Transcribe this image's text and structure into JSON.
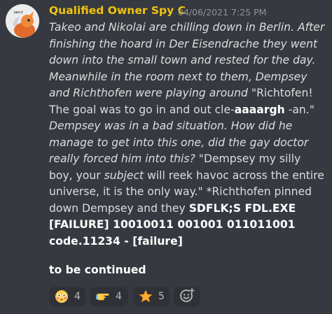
{
  "message": {
    "author": "Qualified Owner Spy C",
    "timestamp": "04/06/2021 7:25 PM",
    "body": [
      {
        "text": "Takeo and Nikolai are chilling down in Berlin. After finishing the hoard in Der Eisendrache they went down into the small town and rested for the day. Meanwhile in the room next to them, Dempsey and Richthofen were playing around ",
        "style": "italic"
      },
      {
        "text": "\"Richtofen! The goal was to go in and out cle-",
        "style": "normal"
      },
      {
        "text": "aaaargh",
        "style": "bold"
      },
      {
        "text": " -an.\" ",
        "style": "normal"
      },
      {
        "text": "Dempsey was in a bad situation. How did he manage to get into this one, did the gay doctor really forced him into this? ",
        "style": "italic"
      },
      {
        "text": "\"Dempsey my silly boy, your ",
        "style": "normal"
      },
      {
        "text": "subject",
        "style": "italic"
      },
      {
        "text": " will reek havoc across the entire universe, it is the only way.\" *Richthofen pinned down Dempsey and they ",
        "style": "normal"
      },
      {
        "text": "SDFLK;S FDL.EXE [FAILURE] 10010011 001001 011011001 code.11234 - [failure]",
        "style": "bold"
      }
    ],
    "footer": "to be continued"
  },
  "reactions": [
    {
      "emoji": "flushed-face",
      "count": "4"
    },
    {
      "emoji": "backhand-index-pointing-right",
      "count": "4"
    },
    {
      "emoji": "star",
      "count": "5"
    }
  ],
  "colors": {
    "background": "#36393f",
    "author": "#f1c40f",
    "text": "#dcddde",
    "timestamp": "#8e9297",
    "reaction_bg": "#2f3136"
  }
}
